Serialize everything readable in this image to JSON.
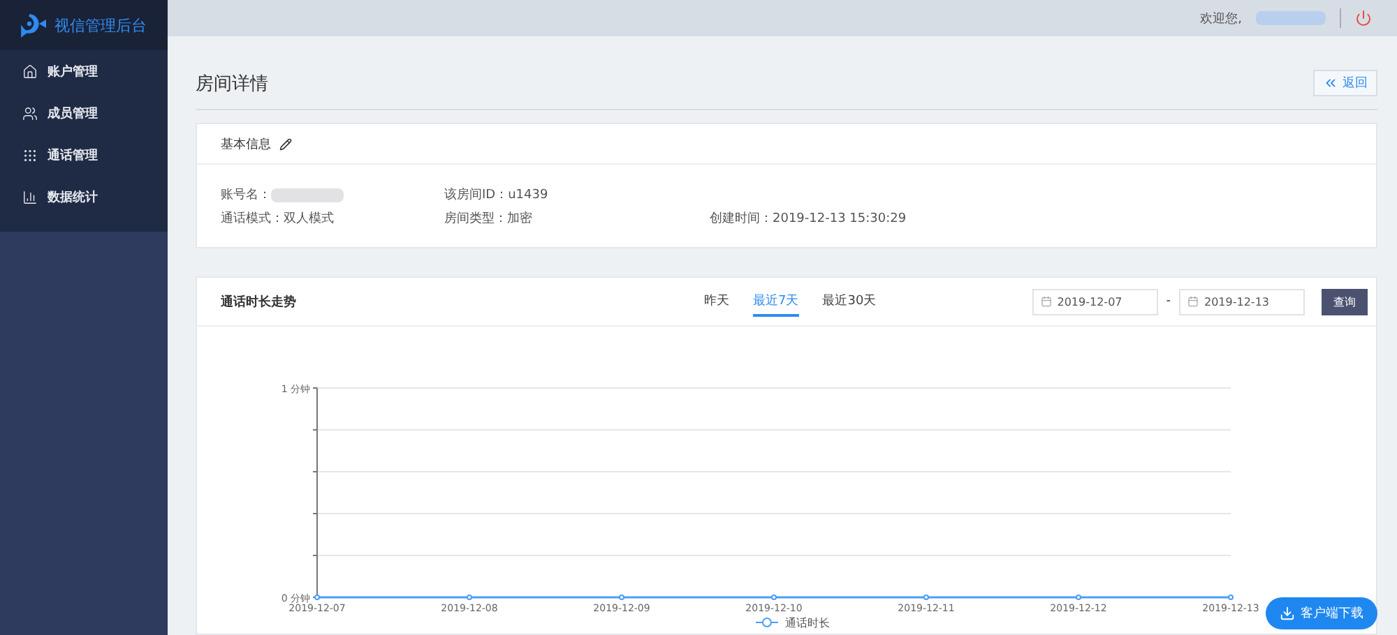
{
  "sidebar": {
    "brand": "视信管理后台",
    "items": [
      {
        "label": "账户管理",
        "selected": false
      },
      {
        "label": "成员管理",
        "selected": false
      },
      {
        "label": "通话管理",
        "selected": false
      },
      {
        "label": "数据统计",
        "selected": false
      }
    ]
  },
  "header": {
    "greeting": "欢迎您,"
  },
  "page": {
    "title": "房间详情",
    "back_button": "返回"
  },
  "basic_info": {
    "title": "基本信息",
    "fields": [
      {
        "label": "账号名："
      },
      {
        "label": "该房间ID：",
        "value": "u1439"
      },
      {
        "label": "通话模式：",
        "value": "双人模式"
      },
      {
        "label": "房间类型：",
        "value": "加密"
      },
      {
        "label": "创建时间：",
        "value": "2019-12-13 15:30:29"
      }
    ]
  },
  "trend": {
    "title": "通话时长走势",
    "tabs": [
      {
        "label": "昨天",
        "selected": false
      },
      {
        "label": "最近7天",
        "selected": true
      },
      {
        "label": "最近30天",
        "selected": false
      }
    ],
    "date_from": "2019-12-07",
    "date_to": "2019-12-13",
    "date_separator": "-",
    "query_button": "查询",
    "chart_data": {
      "type": "line",
      "categories": [
        "2019-12-07",
        "2019-12-08",
        "2019-12-09",
        "2019-12-10",
        "2019-12-11",
        "2019-12-12",
        "2019-12-13"
      ],
      "series": [
        {
          "name": "通话时长",
          "color": "#4a9ff5",
          "marker": "circle",
          "values": [
            0,
            0,
            0,
            0,
            0,
            0,
            0
          ]
        }
      ],
      "ylim": [
        0,
        1
      ],
      "yticks": [
        {
          "value": 0,
          "label": "0 分钟"
        },
        {
          "value": 1,
          "label": "1 分钟"
        }
      ]
    }
  },
  "download_button": "客户端下载"
}
